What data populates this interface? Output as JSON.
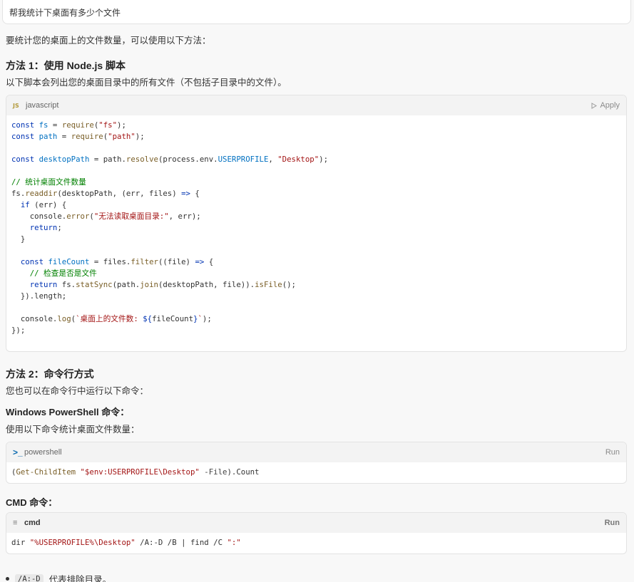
{
  "user_message": "帮我统计下桌面有多少个文件",
  "intro": "要统计您的桌面上的文件数量，可以使用以下方法：",
  "method1": {
    "title": "方法 1：使用 Node.js 脚本",
    "desc": "以下脚本会列出您的桌面目录中的所有文件（不包括子目录中的文件）。",
    "code_lang": "javascript",
    "code_lang_icon": "JS",
    "action": "Apply"
  },
  "method2": {
    "title": "方法 2：命令行方式",
    "desc": "您也可以在命令行中运行以下命令：",
    "ps_title": "Windows PowerShell 命令：",
    "ps_desc": "使用以下命令统计桌面文件数量：",
    "ps_lang": "powershell",
    "ps_action": "Run",
    "cmd_title": "CMD 命令：",
    "cmd_lang": "cmd",
    "cmd_action": "Run"
  },
  "bullet": {
    "code": "/A:-D",
    "text": "代表排除目录。"
  }
}
